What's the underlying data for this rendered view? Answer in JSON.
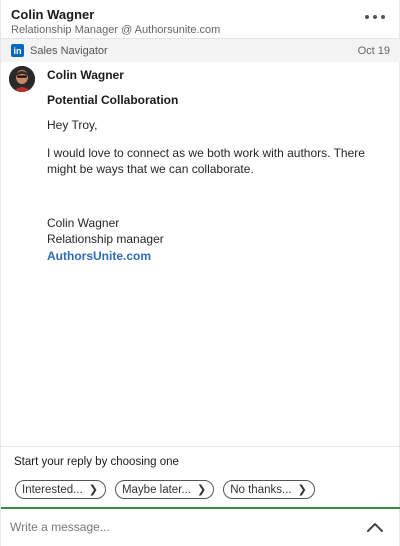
{
  "header": {
    "name": "Colin Wagner",
    "subtitle": "Relationship Manager @ Authorsunite.com"
  },
  "source": {
    "icon_text": "in",
    "label": "Sales Navigator",
    "date": "Oct 19"
  },
  "message": {
    "sender": "Colin Wagner",
    "subject": "Potential Collaboration",
    "greeting": "Hey Troy,",
    "body": "I would love to connect as we both work with authors. There might be ways that we can collaborate.",
    "signature": {
      "name": "Colin Wagner",
      "title": "Relationship manager",
      "link": "AuthorsUnite.com"
    }
  },
  "reply": {
    "prompt": "Start your reply by choosing one",
    "options": [
      {
        "label": "Interested..."
      },
      {
        "label": "Maybe later..."
      },
      {
        "label": "No thanks..."
      }
    ]
  },
  "compose": {
    "placeholder": "Write a message..."
  },
  "colors": {
    "linkedin_blue": "#0a66c2",
    "link": "#2e6bb8",
    "compose_accent": "#3a8a4a"
  },
  "icons": {
    "more": "more-horizontal-icon",
    "source": "linkedin-icon",
    "chip": "chevron-right-icon",
    "expand": "chevron-up-icon"
  }
}
